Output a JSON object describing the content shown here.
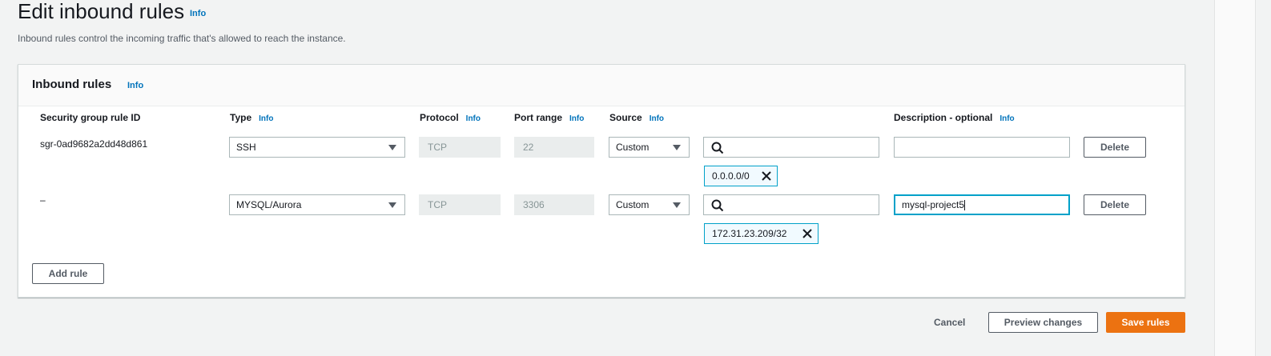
{
  "page": {
    "title": "Edit inbound rules",
    "info": "Info",
    "description": "Inbound rules control the incoming traffic that's allowed to reach the instance."
  },
  "panel": {
    "title": "Inbound rules",
    "info": "Info"
  },
  "columns": {
    "rule_id": "Security group rule ID",
    "type": "Type",
    "protocol": "Protocol",
    "port_range": "Port range",
    "source": "Source",
    "description": "Description - optional",
    "info": "Info"
  },
  "rules": [
    {
      "rule_id": "sgr-0ad9682a2dd48d861",
      "type": "SSH",
      "protocol": "TCP",
      "port_range": "22",
      "source_type": "Custom",
      "source_search": "",
      "source_token": "0.0.0.0/0",
      "description": "",
      "delete_label": "Delete"
    },
    {
      "rule_id": "–",
      "type": "MYSQL/Aurora",
      "protocol": "TCP",
      "port_range": "3306",
      "source_type": "Custom",
      "source_search": "",
      "source_token": "172.31.23.209/32",
      "description": "mysql-project5",
      "delete_label": "Delete"
    }
  ],
  "add_rule_label": "Add rule",
  "footer": {
    "cancel_label": "Cancel",
    "preview_label": "Preview changes",
    "save_label": "Save rules"
  },
  "colors": {
    "primary": "#ec7211",
    "link": "#0073bb",
    "focus": "#00a1c9"
  },
  "icons": {
    "search": "search-icon",
    "dropdown": "caret-down-icon",
    "remove": "close-icon"
  }
}
